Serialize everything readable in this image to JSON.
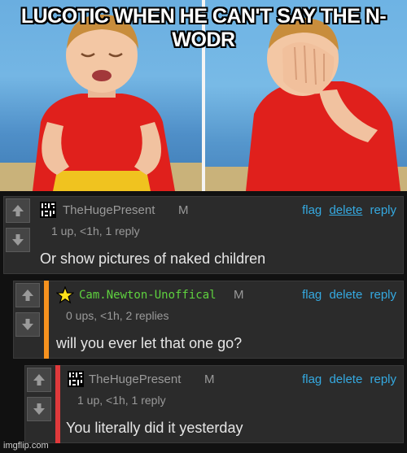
{
  "meme": {
    "caption": "LUCOTIC WHEN HE CAN'T SAY THE N-WODR"
  },
  "comments": [
    {
      "username": "TheHugePresent",
      "badge": "M",
      "meta": "1 up, <1h, 1 reply",
      "text": "Or show pictures of naked children",
      "accent": "",
      "actions": [
        "flag",
        "delete",
        "reply"
      ]
    },
    {
      "username": "Cam.Newton-Unoffical",
      "badge": "M",
      "meta": "0 ups, <1h, 2 replies",
      "text": "will you ever let that one go?",
      "accent": "#f7921e",
      "avatar_icon": "star-icon",
      "actions": [
        "flag",
        "delete",
        "reply"
      ]
    },
    {
      "username": "TheHugePresent",
      "badge": "M",
      "meta": "1 up, <1h, 1 reply",
      "text": "You literally did it yesterday",
      "accent": "#e0393b",
      "actions": [
        "flag",
        "delete",
        "reply"
      ]
    }
  ],
  "watermark": "imgflip.com",
  "colors": {
    "link": "#35a9e0",
    "mod_username": "#5fd23f",
    "reply_accent_1": "#f7921e",
    "reply_accent_2": "#e0393b"
  }
}
